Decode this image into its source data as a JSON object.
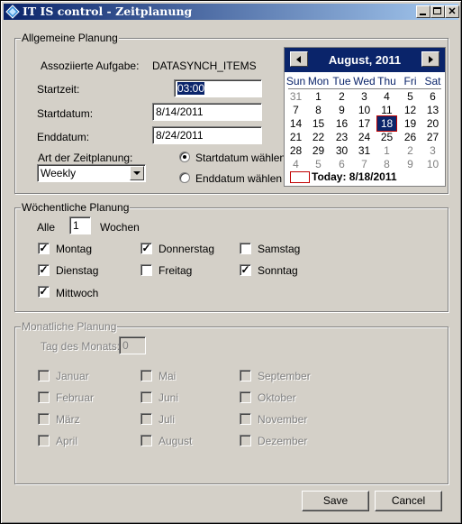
{
  "window": {
    "title": "IT IS control - Zeitplanung"
  },
  "general": {
    "legend": "Allgemeine Planung",
    "task_label": "Assoziierte Aufgabe:",
    "task_value": "DATASYNCH_ITEMS",
    "start_time_label": "Startzeit:",
    "start_time_value": "03:00",
    "start_date_label": "Startdatum:",
    "start_date_value": "8/14/2011",
    "end_date_label": "Enddatum:",
    "end_date_value": "8/24/2011",
    "schedule_type_label": "Art der Zeitplanung:",
    "schedule_type_value": "Weekly",
    "radio_start": "Startdatum wählen",
    "radio_end": "Enddatum wählen"
  },
  "calendar": {
    "month_title": "August, 2011",
    "weekdays": [
      "Sun",
      "Mon",
      "Tue",
      "Wed",
      "Thu",
      "Fri",
      "Sat"
    ],
    "weeks": [
      [
        "31",
        "1",
        "2",
        "3",
        "4",
        "5",
        "6"
      ],
      [
        "7",
        "8",
        "9",
        "10",
        "11",
        "12",
        "13"
      ],
      [
        "14",
        "15",
        "16",
        "17",
        "18",
        "19",
        "20"
      ],
      [
        "21",
        "22",
        "23",
        "24",
        "25",
        "26",
        "27"
      ],
      [
        "28",
        "29",
        "30",
        "31",
        "1",
        "2",
        "3"
      ],
      [
        "4",
        "5",
        "6",
        "7",
        "8",
        "9",
        "10"
      ]
    ],
    "today_label": "Today: 8/18/2011"
  },
  "weekly": {
    "legend": "Wöchentliche Planung",
    "every_label": "Alle",
    "every_value": "1",
    "weeks_label": "Wochen",
    "days": [
      {
        "label": "Montag",
        "checked": true
      },
      {
        "label": "Dienstag",
        "checked": true
      },
      {
        "label": "Mittwoch",
        "checked": true
      },
      {
        "label": "Donnerstag",
        "checked": true
      },
      {
        "label": "Freitag",
        "checked": false
      },
      {
        "label": "Samstag",
        "checked": false
      },
      {
        "label": "Sonntag",
        "checked": true
      }
    ]
  },
  "monthly": {
    "legend": "Monatliche Planung",
    "day_of_month_label": "Tag des Monats:",
    "day_of_month_value": "0",
    "months": [
      "Januar",
      "Februar",
      "März",
      "April",
      "Mai",
      "Juni",
      "Juli",
      "August",
      "September",
      "Oktober",
      "November",
      "Dezember"
    ]
  },
  "buttons": {
    "save": "Save",
    "cancel": "Cancel"
  },
  "colors": {
    "titlebar_start": "#0a246a",
    "titlebar_end": "#a6caf0",
    "selected_day": "#0a246a",
    "today_marker": "#c00000"
  }
}
